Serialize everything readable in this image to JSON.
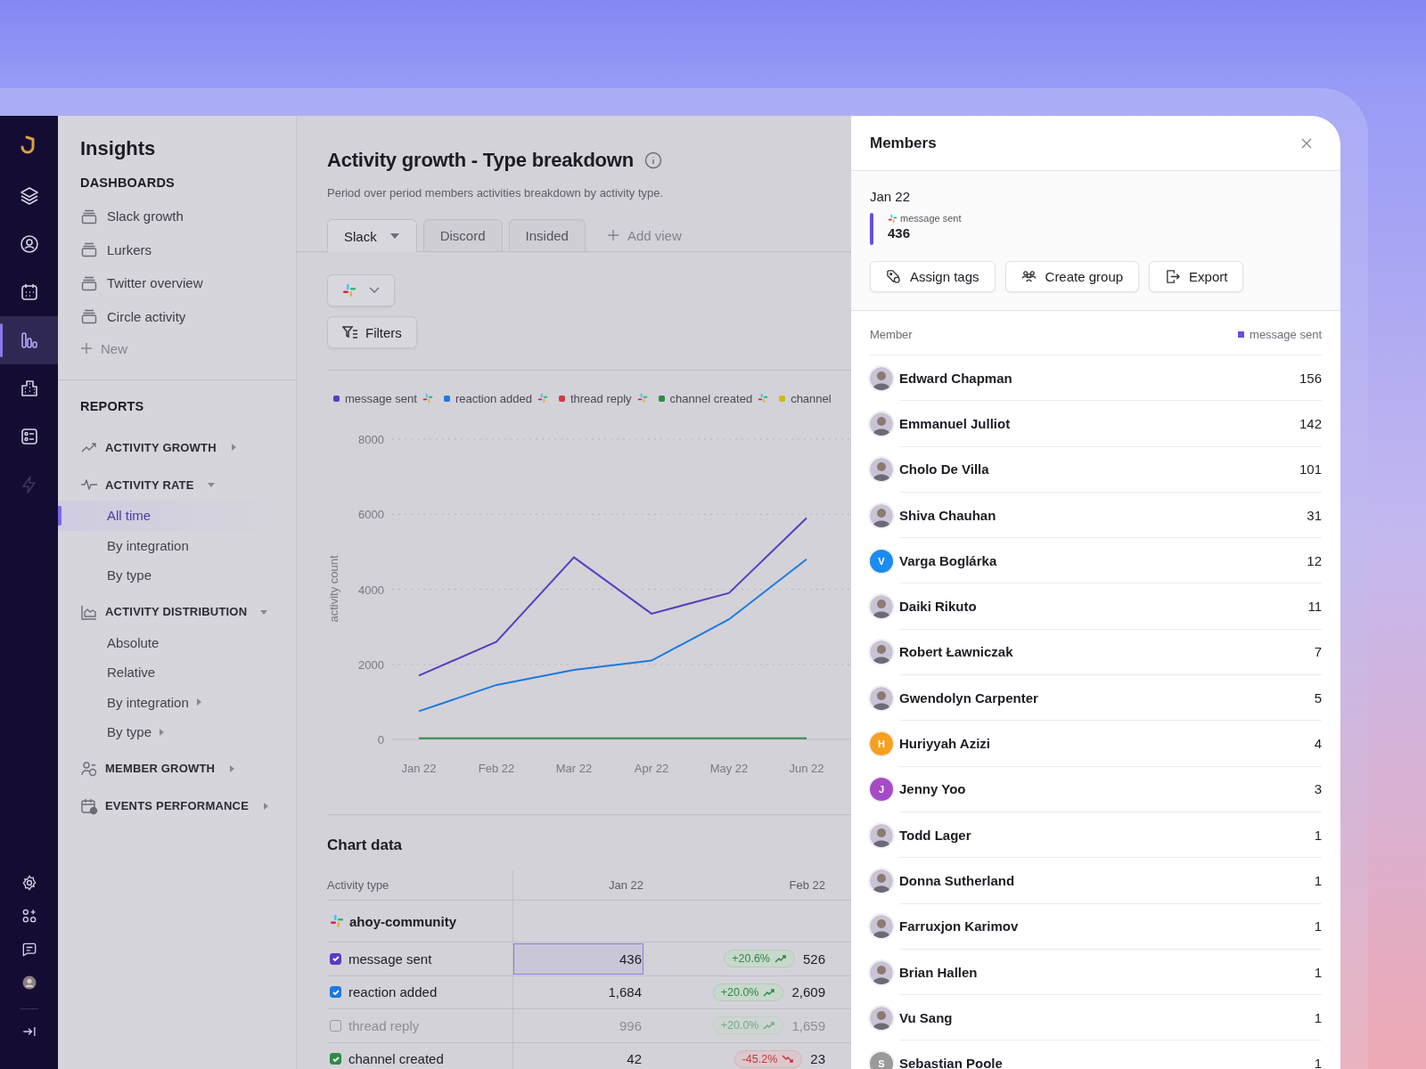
{
  "rail": {
    "top": [
      {
        "kind": "layers",
        "selected": false
      },
      {
        "kind": "user",
        "selected": false
      },
      {
        "kind": "calendar",
        "selected": false
      },
      {
        "kind": "chart",
        "selected": true
      },
      {
        "kind": "building",
        "selected": false
      },
      {
        "kind": "list",
        "selected": false
      },
      {
        "kind": "bolt",
        "selected": false
      }
    ],
    "bottom": [
      {
        "kind": "gear"
      },
      {
        "kind": "apps"
      },
      {
        "kind": "chat"
      },
      {
        "kind": "avatar"
      },
      {
        "kind": "collapse"
      }
    ]
  },
  "sidebar": {
    "title": "Insights",
    "dashboards_heading": "DASHBOARDS",
    "dashboards": [
      "Slack growth",
      "Lurkers",
      "Twitter overview",
      "Circle activity"
    ],
    "new_label": "New",
    "reports_heading": "REPORTS",
    "reports": [
      {
        "label": "ACTIVITY GROWTH",
        "expanded": false
      },
      {
        "label": "ACTIVITY RATE",
        "expanded": true,
        "children": [
          {
            "label": "All time",
            "kind": "link",
            "selected": true
          },
          {
            "label": "By integration",
            "kind": "link",
            "selected": false
          },
          {
            "label": "By type",
            "kind": "link",
            "selected": false
          }
        ]
      },
      {
        "label": "ACTIVITY DISTRIBUTION",
        "expanded": true,
        "children": [
          {
            "label": "Absolute",
            "kind": "link",
            "selected": false
          },
          {
            "label": "Relative",
            "kind": "link",
            "selected": false
          },
          {
            "label": "By integration",
            "kind": "folder",
            "selected": false
          },
          {
            "label": "By type",
            "kind": "folder",
            "selected": false
          }
        ]
      },
      {
        "label": "MEMBER GROWTH",
        "expanded": false
      },
      {
        "label": "EVENTS PERFORMANCE",
        "expanded": false
      }
    ]
  },
  "main": {
    "title": "Activity growth - Type breakdown",
    "subtitle": "Period over period members activities breakdown by activity type.",
    "tabs": [
      {
        "label": "Slack",
        "selected": true
      },
      {
        "label": "Discord",
        "selected": false
      },
      {
        "label": "Insided",
        "selected": false
      }
    ],
    "add_view": "Add view",
    "filters": "Filters",
    "chart_data": {
      "type": "line",
      "grid": true,
      "legend": "top",
      "ylabel": "activity count",
      "categories": [
        "Jan 22",
        "Feb 22",
        "Mar 22",
        "Apr 22",
        "May 22",
        "Jun 22"
      ],
      "ylim": [
        0,
        8000
      ],
      "yticks": [
        0,
        2000,
        4000,
        6000,
        8000
      ],
      "series": [
        {
          "name": "message sent",
          "color": "#5a3dbf",
          "values": [
            1700,
            2600,
            4850,
            3350,
            3900,
            5900
          ]
        },
        {
          "name": "reaction added",
          "color": "#1a7ae0",
          "values": [
            750,
            1450,
            1850,
            2100,
            3200,
            4800
          ]
        },
        {
          "name": "thread reply",
          "color": "#d13b45",
          "values": [
            null,
            null,
            null,
            null,
            null,
            null
          ]
        },
        {
          "name": "channel created",
          "color": "#2f8a45",
          "values": [
            30,
            30,
            30,
            30,
            30,
            30
          ]
        },
        {
          "name": "channel",
          "color": "#d6b71a",
          "values": [
            null,
            null,
            null,
            null,
            null,
            null
          ]
        }
      ]
    },
    "table": {
      "title": "Chart data",
      "columns": [
        "Activity type",
        "Jan 22",
        "Feb 22"
      ],
      "group": "ahoy-community",
      "rows": [
        {
          "label": "message sent",
          "checked": true,
          "color": "#5a3dbf",
          "jan": {
            "value": "436",
            "selected": true
          },
          "feb": {
            "change": "+20.6%",
            "kind": "up",
            "value": "526"
          }
        },
        {
          "label": "reaction added",
          "checked": true,
          "color": "#1a7ae0",
          "jan": {
            "value": "1,684",
            "selected": false
          },
          "feb": {
            "change": "+20.0%",
            "kind": "up",
            "value": "2,609"
          }
        },
        {
          "label": "thread reply",
          "checked": false,
          "jan": {
            "value": "996",
            "selected": false
          },
          "feb": {
            "change": "+20.0%",
            "kind": "up",
            "value": "1,659"
          }
        },
        {
          "label": "channel created",
          "checked": true,
          "color": "#2f8a45",
          "jan": {
            "value": "42",
            "selected": false
          },
          "feb": {
            "change": "-45.2%",
            "kind": "down",
            "value": "23"
          }
        }
      ]
    }
  },
  "panel": {
    "title": "Members",
    "date": "Jan 22",
    "metric": {
      "label": "message sent",
      "value": "436",
      "color": "#6a4de0"
    },
    "actions": [
      {
        "label": "Assign tags"
      },
      {
        "label": "Create group"
      },
      {
        "label": "Export"
      }
    ],
    "list_header": "Member",
    "legend": {
      "label": "message sent",
      "color": "#6a4de0"
    },
    "members": [
      {
        "name": "Edward Chapman",
        "count": "156",
        "kind": "photo"
      },
      {
        "name": "Emmanuel Julliot",
        "count": "142",
        "kind": "photo"
      },
      {
        "name": "Cholo De Villa",
        "count": "101",
        "kind": "photo"
      },
      {
        "name": "Shiva Chauhan",
        "count": "31",
        "kind": "photo"
      },
      {
        "name": "Varga Boglárka",
        "count": "12",
        "kind": "initial",
        "initial": "V",
        "color": "#1a8cf0"
      },
      {
        "name": "Daiki Rikuto",
        "count": "11",
        "kind": "photo"
      },
      {
        "name": "Robert Ławniczak",
        "count": "7",
        "kind": "photo"
      },
      {
        "name": "Gwendolyn Carpenter",
        "count": "5",
        "kind": "photo"
      },
      {
        "name": "Huriyyah Azizi",
        "count": "4",
        "kind": "initial",
        "initial": "H",
        "color": "#f5a020"
      },
      {
        "name": "Jenny Yoo",
        "count": "3",
        "kind": "initial",
        "initial": "J",
        "color": "#a64bc8"
      },
      {
        "name": "Todd Lager",
        "count": "1",
        "kind": "photo"
      },
      {
        "name": "Donna Sutherland",
        "count": "1",
        "kind": "photo"
      },
      {
        "name": "Farruxjon Karimov",
        "count": "1",
        "kind": "photo"
      },
      {
        "name": "Brian Hallen",
        "count": "1",
        "kind": "photo"
      },
      {
        "name": "Vu Sang",
        "count": "1",
        "kind": "photo"
      },
      {
        "name": "Sebastian Poole",
        "count": "1",
        "kind": "initial",
        "initial": "S",
        "color": "#9a9a9a"
      }
    ]
  }
}
